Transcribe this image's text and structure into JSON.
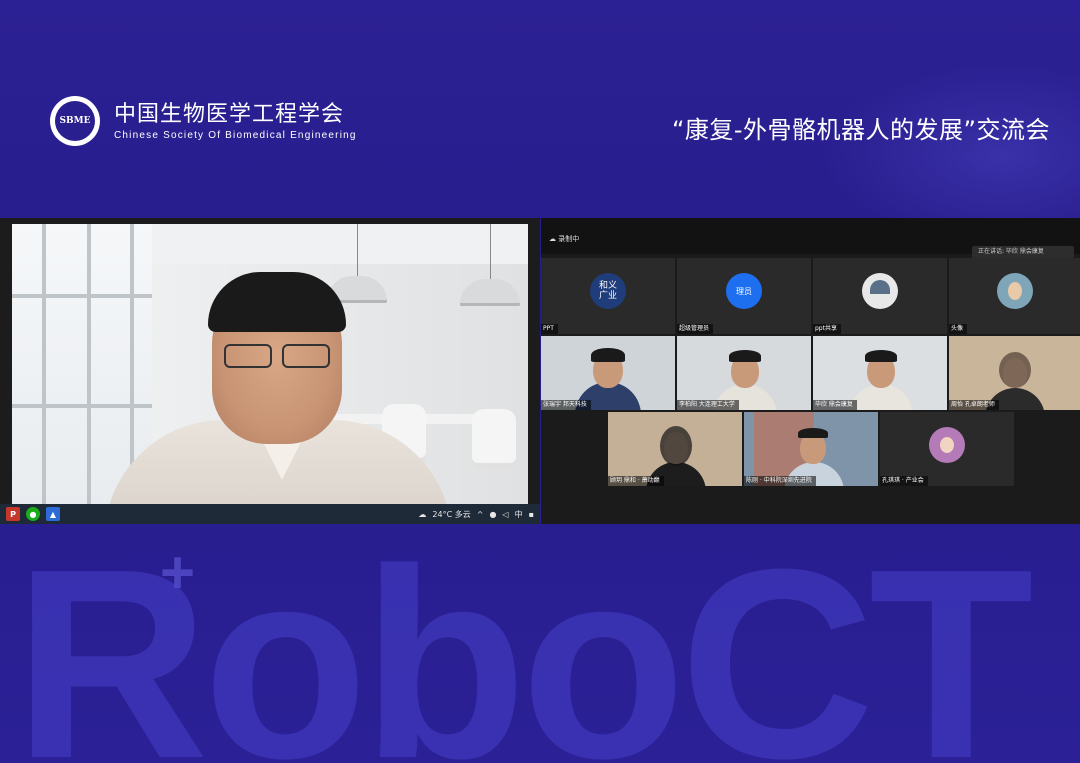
{
  "header": {
    "logo_mark": "SBME",
    "org_cn": "中国生物医学工程学会",
    "org_en": "Chinese Society Of Biomedical Engineering",
    "event_title": "“康复-外骨骼机器人的发展”交流会"
  },
  "left_video": {
    "taskbar": {
      "weather": "24°C 多云",
      "ime": "中"
    }
  },
  "right_video": {
    "top_status": "录制中",
    "speaking": "正在讲话: 毕欣 鼎会康复",
    "tiles": [
      {
        "name": "PPT",
        "avatar_text": "和义\n广业"
      },
      {
        "name": "超级管理员",
        "avatar_text": "理员"
      },
      {
        "name": "ppt共享",
        "avatar_text": ""
      },
      {
        "name": "头像",
        "avatar_text": ""
      },
      {
        "name": "张瑞宇 邦天科技"
      },
      {
        "name": "李柏阳 大连理工大学"
      },
      {
        "name": "毕欣 鼎会康复"
      },
      {
        "name": "周怡 孔卓朗老师"
      },
      {
        "name": "顾玥 鼎和 · 萧动巅"
      },
      {
        "name": "陈刚 · 中科院深圳先进院"
      },
      {
        "name": "孔琪琪 · 产业会"
      }
    ]
  },
  "watermark": {
    "text": "RoboCT",
    "plus": "+"
  },
  "colors": {
    "background": "#2a1f8f",
    "watermark": "#4640c8",
    "tile_bg": "#2a2a2a"
  }
}
